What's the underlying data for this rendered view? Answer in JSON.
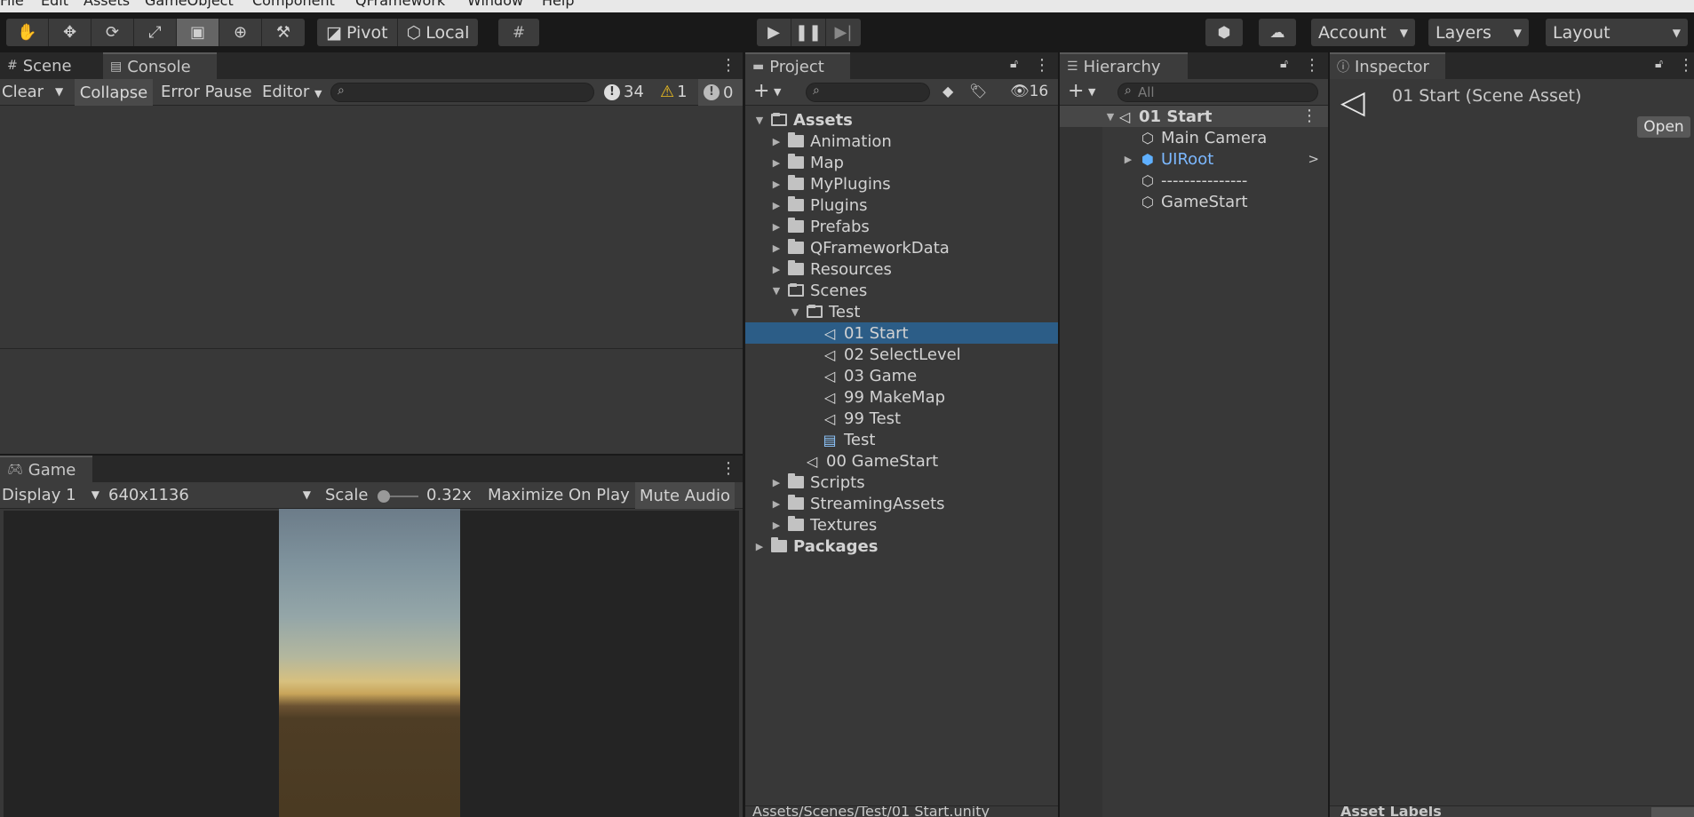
{
  "menu": [
    "File",
    "Edit",
    "Assets",
    "GameObject",
    "Component",
    "QFramework",
    "Window",
    "Help"
  ],
  "toolbar": {
    "pivot": "Pivot",
    "local": "Local",
    "account": "Account",
    "layers": "Layers",
    "layout": "Layout"
  },
  "console": {
    "tabs": [
      "Scene",
      "Console"
    ],
    "clear": "Clear",
    "collapse": "Collapse",
    "error_pause": "Error Pause",
    "editor": "Editor",
    "log_count": "34",
    "warn_count": "1",
    "error_count": "0"
  },
  "game": {
    "tab": "Game",
    "display": "Display 1",
    "resolution": "640x1136",
    "scale_label": "Scale",
    "scale_value": "0.32x",
    "maximize": "Maximize On Play",
    "mute": "Mute Audio"
  },
  "project": {
    "tab": "Project",
    "hidden_count": "16",
    "tree": [
      {
        "label": "Assets",
        "bold": true
      },
      {
        "label": "Animation"
      },
      {
        "label": "Map"
      },
      {
        "label": "MyPlugins"
      },
      {
        "label": "Plugins"
      },
      {
        "label": "Prefabs"
      },
      {
        "label": "QFrameworkData"
      },
      {
        "label": "Resources"
      },
      {
        "label": "Scenes"
      },
      {
        "label": "Test"
      },
      {
        "label": "01 Start"
      },
      {
        "label": "02 SelectLevel"
      },
      {
        "label": "03 Game"
      },
      {
        "label": "99 MakeMap"
      },
      {
        "label": "99 Test"
      },
      {
        "label": "Test"
      },
      {
        "label": "00 GameStart"
      },
      {
        "label": "Scripts"
      },
      {
        "label": "StreamingAssets"
      },
      {
        "label": "Textures"
      },
      {
        "label": "Packages",
        "bold": true
      }
    ],
    "path": "Assets/Scenes/Test/01 Start.unity"
  },
  "hierarchy": {
    "tab": "Hierarchy",
    "search_placeholder": "All",
    "items": [
      "01 Start",
      "Main Camera",
      "UIRoot",
      "---------------",
      "GameStart"
    ]
  },
  "inspector": {
    "tab": "Inspector",
    "title": "01 Start (Scene Asset)",
    "open": "Open",
    "asset_labels": "Asset Labels"
  }
}
